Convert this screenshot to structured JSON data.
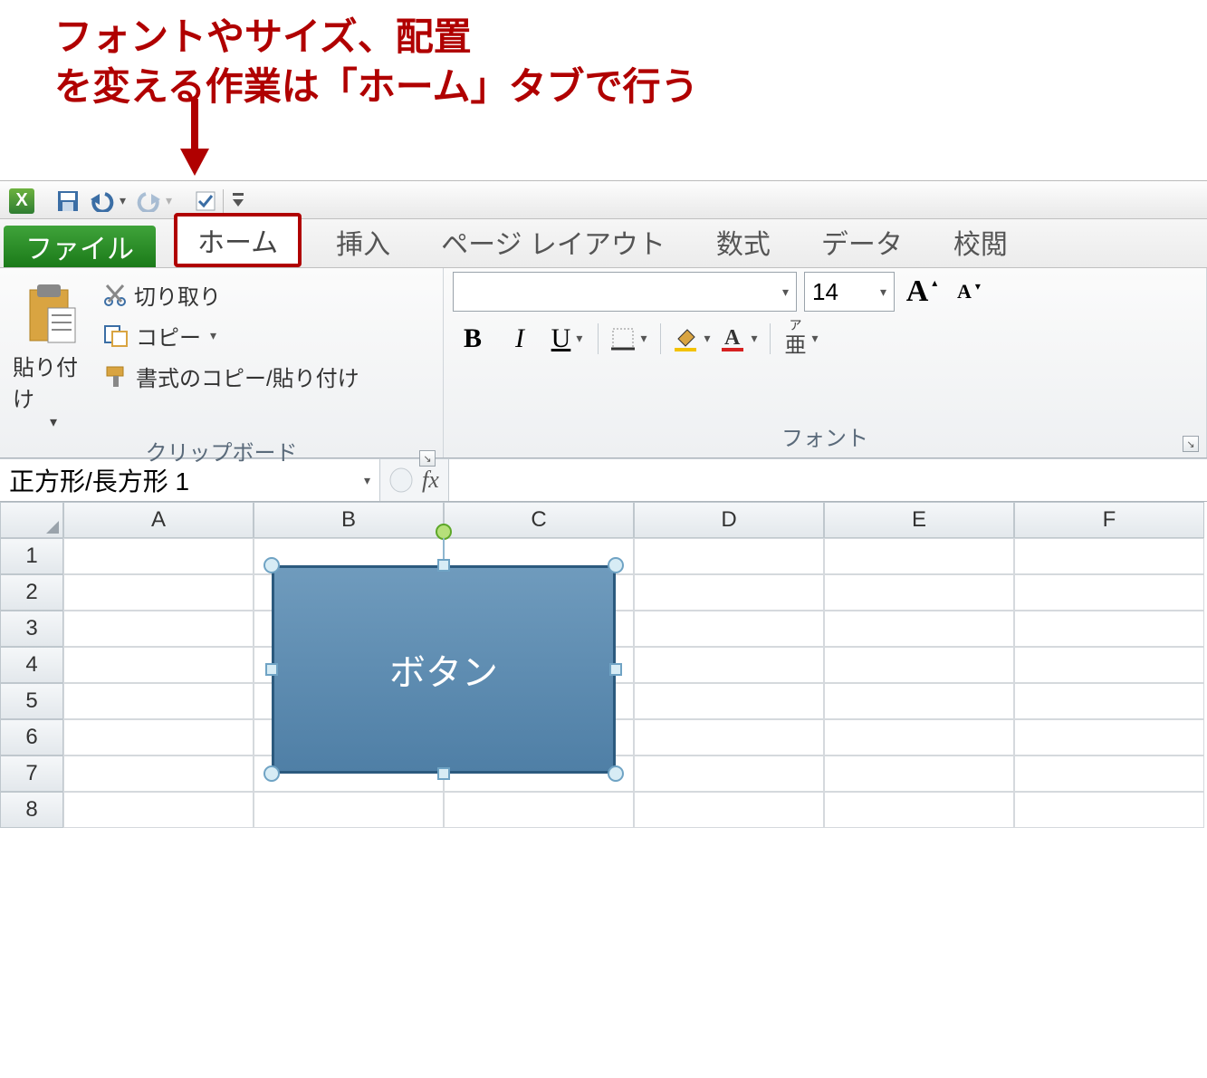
{
  "callout": {
    "line1": "フォントやサイズ、配置",
    "line2": "を変える作業は「ホーム」タブで行う"
  },
  "qat": {
    "app": "X",
    "save": "save-icon",
    "undo": "undo-icon",
    "redo": "redo-icon"
  },
  "tabs": {
    "file": "ファイル",
    "items": [
      "ホーム",
      "挿入",
      "ページ レイアウト",
      "数式",
      "データ",
      "校閲"
    ],
    "activeIndex": 0
  },
  "ribbon": {
    "clipboard": {
      "title": "クリップボード",
      "paste": "貼り付け",
      "cut": "切り取り",
      "copy": "コピー",
      "format_painter": "書式のコピー/貼り付け"
    },
    "font": {
      "title": "フォント",
      "size": "14",
      "bold": "B",
      "italic": "I",
      "underline": "U",
      "grow": "A",
      "shrink": "A",
      "phonetic_top": "ア",
      "phonetic_bottom": "亜"
    }
  },
  "namebar": {
    "name": "正方形/長方形 1",
    "fx": "fx"
  },
  "grid": {
    "columns": [
      "A",
      "B",
      "C",
      "D",
      "E",
      "F"
    ],
    "rows": [
      "1",
      "2",
      "3",
      "4",
      "5",
      "6",
      "7",
      "8"
    ]
  },
  "shape": {
    "text": "ボタン"
  }
}
